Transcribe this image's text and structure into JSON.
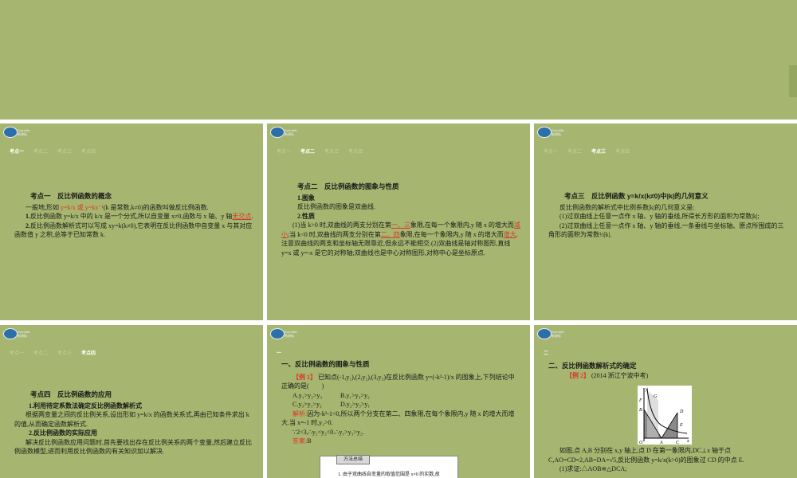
{
  "nav_labels": [
    "考点一",
    "考点二",
    "考点三",
    "考点四"
  ],
  "logo_text": [
    "Scientific",
    "新课标"
  ],
  "slide1": {
    "title": "考点一　反比例函数的概念",
    "p1_a": "一般地,形如 ",
    "p1_hl": "y=k/x 或 y=kx⁻¹",
    "p1_b": "(k 是常数,k≠0)的函数叫做反比例函数.",
    "p2_num": "1.",
    "p2_a": "反比例函数 y=k/x 中的 k/x 是一个分式,所以自变量 x≠0,函数与 x 轴、y 轴",
    "p2_hl": "无交点",
    "p2_b": ".",
    "p3_num": "2.",
    "p3": "反比例函数解析式可以写成 xy=k(k≠0),它表明在反比例函数中自变量 x 与其对应函数值 y 之积,总等于已知常数 k."
  },
  "slide2": {
    "title": "考点二　反比例函数的图象与性质",
    "s1": "1.图象",
    "s1_text": "反比例函数的图象是双曲线.",
    "s2": "2.性质",
    "p_a": "(1)当 k>0 时,双曲线的两支分别在第",
    "p_hl1": "一、三",
    "p_b": "象限,在每一个象限内,y 随 x 的增大而",
    "p_hl2": "减小",
    "p_c": ";当 k<0 时,双曲线的两支分别在第",
    "p_hl3": "二、四",
    "p_d": "象限,在每一个象限内,y 随 x 的增大而",
    "p_hl4": "增大",
    "p_e": ".注意双曲线的两支和坐标轴无限靠近,但永远不能相交.(2)双曲线是轴对称图形,直线 y=x 或 y=-x 是它的对称轴;双曲线也是中心对称图形,对称中心是坐标原点."
  },
  "slide3": {
    "title": "考点三　反比例函数 y=k/x(k≠0)中|k|的几何意义",
    "p0": "反比例函数的解析式中比例系数|k|的几何意义是:",
    "p1": "(1)过双曲线上任意一点作 x 轴、y 轴的垂线,所得长方形的面积为常数|k|;",
    "p2": "(2)过双曲线上任意一点作 x 轴、y 轴的垂线,一条垂线与坐标轴、原点所围成的三角形的面积为常数½|k|."
  },
  "slide4": {
    "title": "考点四　反比例函数的应用",
    "s1": "1.利用待定系数法确定反比例函数解析式",
    "p1": "根据两变量之间的反比例关系,设出形如 y=k/x 的函数关系式,再由已知条件求出 k 的值,从而确定函数解析式.",
    "s2": "2.反比例函数的实际应用",
    "p2": "解决反比例函数应用问题时,首先要找出存在反比例关系的两个变量,然后建立反比例函数模型,进而利用反比例函数的有关知识加以解决."
  },
  "slide5": {
    "tag": "一",
    "title": "一、反比例函数的图象与性质",
    "ex_label": "【例 1】",
    "ex_text": "已知点(-1,y₁),(2,y₂),(3,y₃)在反比例函数 y=(-k²-1)/x 的图象上,下列结论中正确的是(　　)",
    "options": [
      "A.y₁>y₂>y₃",
      "B.y₁>y₃>y₂",
      "C.y₃>y₁>y₂",
      "D.y₂>y₃>y₁"
    ],
    "analysis_label": "解析:",
    "analysis": "因为-k²-1<0,所以两个分支在第二、四象限,在每个象限内,y 随 x 的增大而增大.当 x=-1 时,y₁>0.",
    "analysis2": "∵2<3,∴y₂<y₃<0.∴y₁>y₃>y₂.",
    "answer_label": "答案:",
    "answer": "B",
    "method_tab": "方法总结",
    "method_line": "1. 由于双曲线自变量的取值范围是 x≠0 的实数,故"
  },
  "slide6": {
    "tag": "二",
    "title": "二、反比例函数解析式的确定",
    "ex_label": "【例 2】",
    "ex_source": "(2014 浙江宁波中考)",
    "fig_labels": [
      "y",
      "G",
      "F",
      "B",
      "D",
      "E",
      "O",
      "A",
      "C",
      "x"
    ],
    "p1": "如图,点 A,B 分别在 x,y 轴上,点 D 在第一象限内,DC⊥x 轴于点 C,AO=CD=2,AB=DA=√5,反比例函数 y=k/x(k>0)的图象过 CD 的中点 E.",
    "p2": "(1)求证:△AOB≌△DCA;"
  }
}
